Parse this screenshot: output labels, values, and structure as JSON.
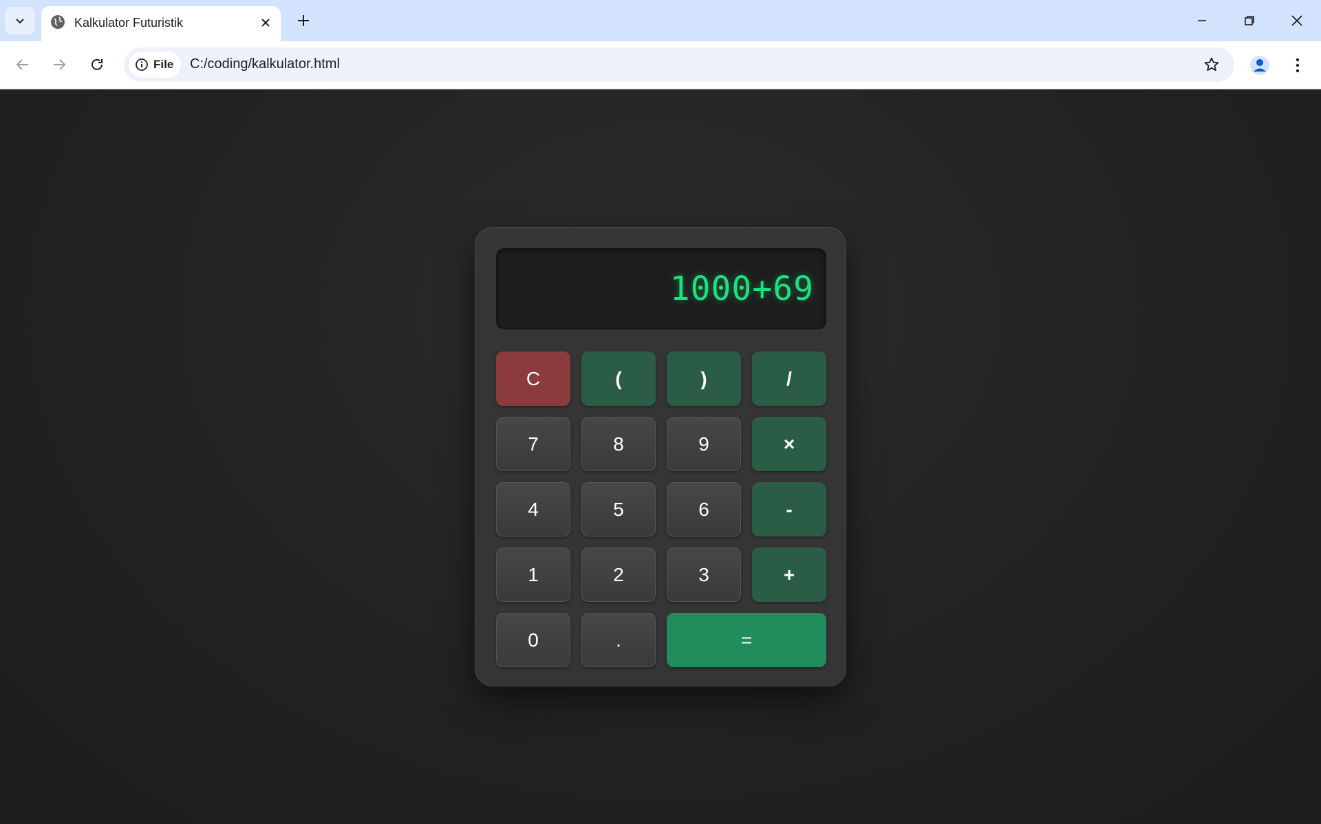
{
  "browser": {
    "tab_title": "Kalkulator Futuristik",
    "url_chip": "File",
    "url": "C:/coding/kalkulator.html"
  },
  "calculator": {
    "display": "1000+69",
    "keys": [
      {
        "label": "C",
        "kind": "clear",
        "name": "clear-button"
      },
      {
        "label": "(",
        "kind": "op",
        "name": "open-paren-button"
      },
      {
        "label": ")",
        "kind": "op",
        "name": "close-paren-button"
      },
      {
        "label": "/",
        "kind": "op",
        "name": "divide-button"
      },
      {
        "label": "7",
        "kind": "num",
        "name": "digit-7-button"
      },
      {
        "label": "8",
        "kind": "num",
        "name": "digit-8-button"
      },
      {
        "label": "9",
        "kind": "num",
        "name": "digit-9-button"
      },
      {
        "label": "×",
        "kind": "op",
        "name": "multiply-button"
      },
      {
        "label": "4",
        "kind": "num",
        "name": "digit-4-button"
      },
      {
        "label": "5",
        "kind": "num",
        "name": "digit-5-button"
      },
      {
        "label": "6",
        "kind": "num",
        "name": "digit-6-button"
      },
      {
        "label": "-",
        "kind": "op",
        "name": "subtract-button"
      },
      {
        "label": "1",
        "kind": "num",
        "name": "digit-1-button"
      },
      {
        "label": "2",
        "kind": "num",
        "name": "digit-2-button"
      },
      {
        "label": "3",
        "kind": "num",
        "name": "digit-3-button"
      },
      {
        "label": "+",
        "kind": "op",
        "name": "add-button"
      },
      {
        "label": "0",
        "kind": "num",
        "name": "digit-0-button"
      },
      {
        "label": ".",
        "kind": "num",
        "name": "decimal-button"
      },
      {
        "label": "=",
        "kind": "equals",
        "name": "equals-button"
      }
    ]
  },
  "colors": {
    "tabbar": "#d3e3fd",
    "display_text": "#1ee07f",
    "clear_key": "#8b3a3d",
    "operator_key": "#2a5c46",
    "equals_key": "#238c5c",
    "number_key": "#404040"
  }
}
